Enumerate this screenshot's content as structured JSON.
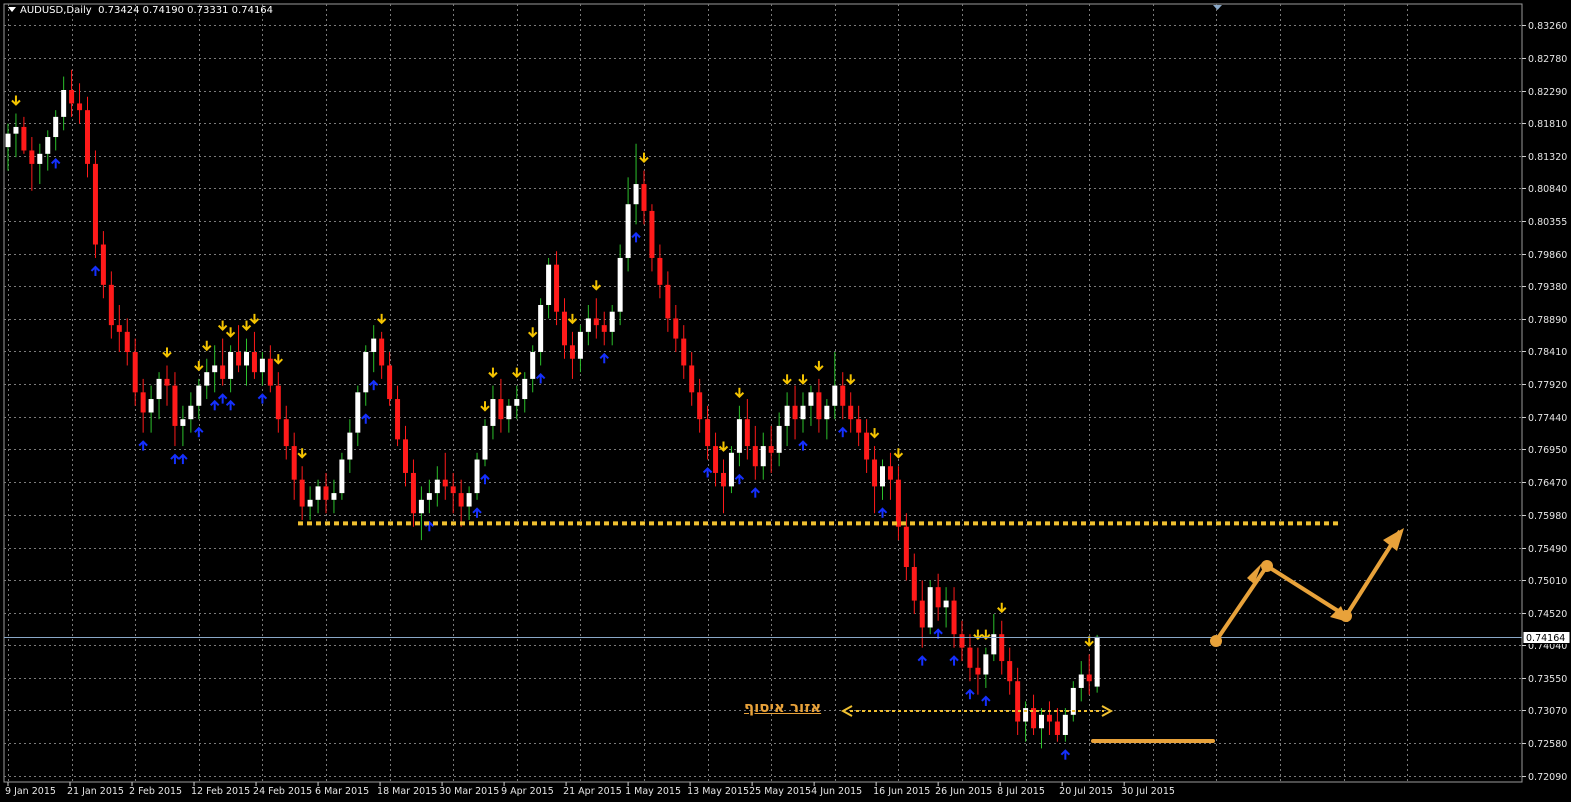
{
  "header": {
    "symbol": "AUDUSD,Daily",
    "ohlc": "0.73424 0.74190 0.73331 0.74164"
  },
  "annotation": {
    "zone_label": "אזור איסוף"
  },
  "colors": {
    "background": "#000000",
    "grid": "#7A7A7A",
    "bull_candle": "#FFFFFF",
    "bear_candle": "#FF1A1A",
    "up_arrow": "#1530FF",
    "down_arrow": "#F5C400",
    "support_line": "#F0C030",
    "projection": "#E8A23A",
    "current_price_line": "#8AA8C8"
  },
  "chart_data": {
    "type": "candlestick",
    "title": "AUDUSD,Daily",
    "current_price": "0.74164",
    "ylim": [
      0.72,
      0.8358
    ],
    "grid": true,
    "y_ticks": [
      "0.83260",
      "0.82780",
      "0.82290",
      "0.81810",
      "0.81320",
      "0.80840",
      "0.80355",
      "0.79860",
      "0.79380",
      "0.78890",
      "0.78410",
      "0.77920",
      "0.77440",
      "0.76950",
      "0.76470",
      "0.75980",
      "0.75490",
      "0.75010",
      "0.74520",
      "0.74040",
      "0.73550",
      "0.73070",
      "0.72580",
      "0.72090"
    ],
    "x_ticks": [
      "9 Jan 2015",
      "21 Jan 2015",
      "2 Feb 2015",
      "12 Feb 2015",
      "24 Feb 2015",
      "6 Mar 2015",
      "18 Mar 2015",
      "30 Mar 2015",
      "9 Apr 2015",
      "21 Apr 2015",
      "1 May 2015",
      "13 May 2015",
      "25 May 2015",
      "4 Jun 2015",
      "16 Jun 2015",
      "26 Jun 2015",
      "8 Jul 2015",
      "20 Jul 2015",
      "30 Jul 2015"
    ],
    "support_level": 0.7585,
    "ohlc": [
      [
        0.8145,
        0.818,
        0.811,
        0.8165
      ],
      [
        0.8165,
        0.8195,
        0.813,
        0.8175
      ],
      [
        0.8175,
        0.819,
        0.8135,
        0.814
      ],
      [
        0.814,
        0.816,
        0.808,
        0.812
      ],
      [
        0.812,
        0.815,
        0.809,
        0.8135
      ],
      [
        0.8135,
        0.817,
        0.811,
        0.816
      ],
      [
        0.816,
        0.82,
        0.814,
        0.819
      ],
      [
        0.819,
        0.825,
        0.817,
        0.823
      ],
      [
        0.823,
        0.826,
        0.819,
        0.821
      ],
      [
        0.821,
        0.824,
        0.818,
        0.82
      ],
      [
        0.82,
        0.822,
        0.81,
        0.812
      ],
      [
        0.812,
        0.814,
        0.798,
        0.8
      ],
      [
        0.8,
        0.802,
        0.792,
        0.794
      ],
      [
        0.794,
        0.796,
        0.786,
        0.788
      ],
      [
        0.788,
        0.791,
        0.784,
        0.787
      ],
      [
        0.787,
        0.789,
        0.782,
        0.784
      ],
      [
        0.784,
        0.786,
        0.776,
        0.778
      ],
      [
        0.778,
        0.78,
        0.772,
        0.775
      ],
      [
        0.775,
        0.779,
        0.772,
        0.777
      ],
      [
        0.777,
        0.781,
        0.774,
        0.78
      ],
      [
        0.78,
        0.782,
        0.776,
        0.779
      ],
      [
        0.779,
        0.781,
        0.77,
        0.773
      ],
      [
        0.773,
        0.776,
        0.77,
        0.774
      ],
      [
        0.774,
        0.778,
        0.772,
        0.776
      ],
      [
        0.776,
        0.78,
        0.774,
        0.779
      ],
      [
        0.779,
        0.783,
        0.777,
        0.781
      ],
      [
        0.781,
        0.785,
        0.778,
        0.782
      ],
      [
        0.782,
        0.786,
        0.779,
        0.78
      ],
      [
        0.78,
        0.785,
        0.778,
        0.784
      ],
      [
        0.784,
        0.788,
        0.781,
        0.782
      ],
      [
        0.782,
        0.786,
        0.779,
        0.784
      ],
      [
        0.784,
        0.787,
        0.78,
        0.781
      ],
      [
        0.781,
        0.784,
        0.779,
        0.783
      ],
      [
        0.783,
        0.785,
        0.778,
        0.779
      ],
      [
        0.779,
        0.781,
        0.772,
        0.774
      ],
      [
        0.774,
        0.776,
        0.768,
        0.77
      ],
      [
        0.77,
        0.772,
        0.762,
        0.765
      ],
      [
        0.765,
        0.767,
        0.759,
        0.761
      ],
      [
        0.761,
        0.764,
        0.759,
        0.762
      ],
      [
        0.762,
        0.765,
        0.76,
        0.764
      ],
      [
        0.764,
        0.766,
        0.76,
        0.762
      ],
      [
        0.762,
        0.765,
        0.76,
        0.763
      ],
      [
        0.763,
        0.769,
        0.762,
        0.768
      ],
      [
        0.768,
        0.774,
        0.766,
        0.772
      ],
      [
        0.772,
        0.779,
        0.77,
        0.778
      ],
      [
        0.778,
        0.785,
        0.776,
        0.784
      ],
      [
        0.784,
        0.788,
        0.781,
        0.786
      ],
      [
        0.786,
        0.787,
        0.78,
        0.782
      ],
      [
        0.782,
        0.784,
        0.776,
        0.777
      ],
      [
        0.777,
        0.779,
        0.77,
        0.771
      ],
      [
        0.771,
        0.773,
        0.764,
        0.766
      ],
      [
        0.766,
        0.768,
        0.758,
        0.76
      ],
      [
        0.76,
        0.764,
        0.756,
        0.762
      ],
      [
        0.762,
        0.765,
        0.76,
        0.763
      ],
      [
        0.763,
        0.767,
        0.761,
        0.765
      ],
      [
        0.765,
        0.769,
        0.762,
        0.764
      ],
      [
        0.764,
        0.766,
        0.76,
        0.763
      ],
      [
        0.763,
        0.765,
        0.758,
        0.761
      ],
      [
        0.761,
        0.764,
        0.759,
        0.763
      ],
      [
        0.763,
        0.769,
        0.762,
        0.768
      ],
      [
        0.768,
        0.774,
        0.767,
        0.773
      ],
      [
        0.773,
        0.779,
        0.771,
        0.777
      ],
      [
        0.777,
        0.78,
        0.772,
        0.774
      ],
      [
        0.774,
        0.777,
        0.772,
        0.776
      ],
      [
        0.776,
        0.779,
        0.774,
        0.777
      ],
      [
        0.777,
        0.781,
        0.775,
        0.78
      ],
      [
        0.78,
        0.785,
        0.778,
        0.784
      ],
      [
        0.784,
        0.792,
        0.782,
        0.791
      ],
      [
        0.791,
        0.798,
        0.789,
        0.797
      ],
      [
        0.797,
        0.799,
        0.788,
        0.79
      ],
      [
        0.79,
        0.792,
        0.783,
        0.785
      ],
      [
        0.785,
        0.787,
        0.78,
        0.783
      ],
      [
        0.783,
        0.788,
        0.781,
        0.787
      ],
      [
        0.787,
        0.791,
        0.785,
        0.789
      ],
      [
        0.789,
        0.792,
        0.786,
        0.788
      ],
      [
        0.788,
        0.79,
        0.785,
        0.787
      ],
      [
        0.787,
        0.791,
        0.785,
        0.79
      ],
      [
        0.79,
        0.8,
        0.788,
        0.798
      ],
      [
        0.798,
        0.81,
        0.796,
        0.806
      ],
      [
        0.806,
        0.815,
        0.803,
        0.809
      ],
      [
        0.809,
        0.811,
        0.803,
        0.805
      ],
      [
        0.805,
        0.806,
        0.796,
        0.798
      ],
      [
        0.798,
        0.8,
        0.792,
        0.794
      ],
      [
        0.794,
        0.796,
        0.787,
        0.789
      ],
      [
        0.789,
        0.791,
        0.784,
        0.786
      ],
      [
        0.786,
        0.788,
        0.78,
        0.782
      ],
      [
        0.782,
        0.784,
        0.776,
        0.778
      ],
      [
        0.778,
        0.78,
        0.772,
        0.774
      ],
      [
        0.774,
        0.776,
        0.768,
        0.77
      ],
      [
        0.77,
        0.772,
        0.764,
        0.766
      ],
      [
        0.766,
        0.768,
        0.76,
        0.764
      ],
      [
        0.764,
        0.77,
        0.763,
        0.769
      ],
      [
        0.769,
        0.776,
        0.767,
        0.774
      ],
      [
        0.774,
        0.777,
        0.768,
        0.77
      ],
      [
        0.77,
        0.773,
        0.765,
        0.767
      ],
      [
        0.767,
        0.772,
        0.765,
        0.77
      ],
      [
        0.77,
        0.773,
        0.766,
        0.769
      ],
      [
        0.769,
        0.775,
        0.767,
        0.773
      ],
      [
        0.773,
        0.778,
        0.77,
        0.776
      ],
      [
        0.776,
        0.779,
        0.771,
        0.774
      ],
      [
        0.774,
        0.778,
        0.772,
        0.776
      ],
      [
        0.776,
        0.779,
        0.773,
        0.778
      ],
      [
        0.778,
        0.78,
        0.772,
        0.774
      ],
      [
        0.774,
        0.777,
        0.771,
        0.776
      ],
      [
        0.776,
        0.784,
        0.774,
        0.779
      ],
      [
        0.779,
        0.781,
        0.774,
        0.776
      ],
      [
        0.776,
        0.778,
        0.772,
        0.774
      ],
      [
        0.774,
        0.776,
        0.77,
        0.772
      ],
      [
        0.772,
        0.774,
        0.766,
        0.768
      ],
      [
        0.768,
        0.77,
        0.76,
        0.764
      ],
      [
        0.764,
        0.768,
        0.762,
        0.767
      ],
      [
        0.767,
        0.769,
        0.762,
        0.765
      ],
      [
        0.765,
        0.767,
        0.756,
        0.758
      ],
      [
        0.758,
        0.76,
        0.75,
        0.752
      ],
      [
        0.752,
        0.754,
        0.745,
        0.747
      ],
      [
        0.747,
        0.75,
        0.74,
        0.743
      ],
      [
        0.743,
        0.75,
        0.742,
        0.749
      ],
      [
        0.749,
        0.751,
        0.744,
        0.746
      ],
      [
        0.746,
        0.749,
        0.743,
        0.747
      ],
      [
        0.747,
        0.749,
        0.74,
        0.742
      ],
      [
        0.742,
        0.744,
        0.738,
        0.74
      ],
      [
        0.74,
        0.742,
        0.735,
        0.737
      ],
      [
        0.737,
        0.74,
        0.733,
        0.736
      ],
      [
        0.736,
        0.74,
        0.734,
        0.739
      ],
      [
        0.739,
        0.745,
        0.738,
        0.742
      ],
      [
        0.742,
        0.744,
        0.736,
        0.738
      ],
      [
        0.738,
        0.74,
        0.733,
        0.735
      ],
      [
        0.735,
        0.737,
        0.727,
        0.729
      ],
      [
        0.729,
        0.732,
        0.726,
        0.731
      ],
      [
        0.731,
        0.733,
        0.727,
        0.728
      ],
      [
        0.728,
        0.731,
        0.725,
        0.73
      ],
      [
        0.73,
        0.732,
        0.727,
        0.729
      ],
      [
        0.729,
        0.731,
        0.726,
        0.727
      ],
      [
        0.727,
        0.731,
        0.726,
        0.73
      ],
      [
        0.73,
        0.735,
        0.729,
        0.734
      ],
      [
        0.734,
        0.738,
        0.732,
        0.736
      ],
      [
        0.736,
        0.739,
        0.733,
        0.735
      ],
      [
        0.7342,
        0.7419,
        0.7333,
        0.7416
      ]
    ],
    "arrows_up": [
      6,
      11,
      17,
      21,
      22,
      24,
      26,
      27,
      28,
      32,
      45,
      46,
      53,
      59,
      60,
      67,
      75,
      79,
      88,
      92,
      94,
      100,
      105,
      110,
      115,
      117,
      119,
      121,
      123,
      133,
      139
    ],
    "arrows_down": [
      1,
      20,
      24,
      25,
      27,
      28,
      30,
      31,
      34,
      37,
      47,
      60,
      61,
      64,
      66,
      71,
      74,
      80,
      90,
      92,
      98,
      100,
      102,
      106,
      109,
      112,
      122,
      123,
      125,
      136
    ]
  }
}
